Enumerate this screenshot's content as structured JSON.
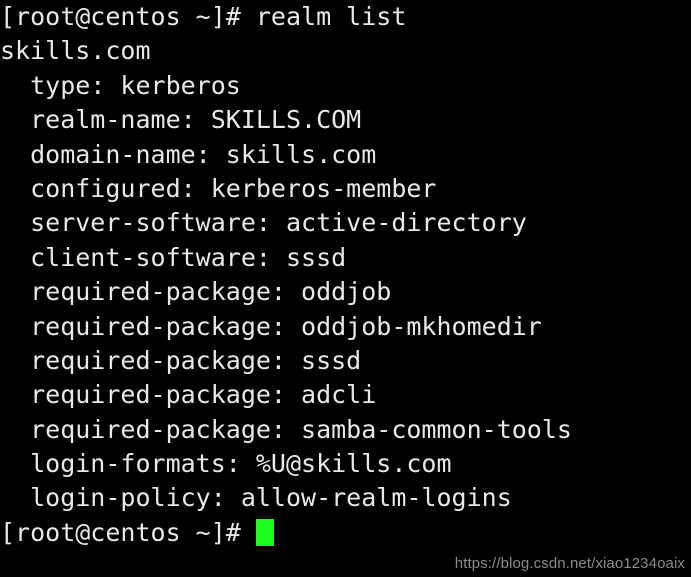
{
  "terminal": {
    "background_color": "#000000",
    "foreground_color": "#e8e8e8",
    "cursor_color": "#19ff19",
    "lines": [
      {
        "id": "line-1",
        "text": "[root@centos ~]# realm list"
      },
      {
        "id": "line-2",
        "text": "skills.com"
      },
      {
        "id": "line-3",
        "text": "  type: kerberos"
      },
      {
        "id": "line-4",
        "text": "  realm-name: SKILLS.COM"
      },
      {
        "id": "line-5",
        "text": "  domain-name: skills.com"
      },
      {
        "id": "line-6",
        "text": "  configured: kerberos-member"
      },
      {
        "id": "line-7",
        "text": "  server-software: active-directory"
      },
      {
        "id": "line-8",
        "text": "  client-software: sssd"
      },
      {
        "id": "line-9",
        "text": "  required-package: oddjob"
      },
      {
        "id": "line-10",
        "text": "  required-package: oddjob-mkhomedir"
      },
      {
        "id": "line-11",
        "text": "  required-package: sssd"
      },
      {
        "id": "line-12",
        "text": "  required-package: adcli"
      },
      {
        "id": "line-13",
        "text": "  required-package: samba-common-tools"
      },
      {
        "id": "line-14",
        "text": "  login-formats: %U@skills.com"
      },
      {
        "id": "line-15",
        "text": "  login-policy: allow-realm-logins"
      }
    ],
    "final_prompt": "[root@centos ~]# ",
    "command_entered": "realm list",
    "hostname": "centos",
    "user": "root",
    "working_directory": "~",
    "realm_name": "skills.com"
  },
  "watermark": {
    "text": "https://blog.csdn.net/xiao1234oaix",
    "color": "#8a8a8a"
  }
}
